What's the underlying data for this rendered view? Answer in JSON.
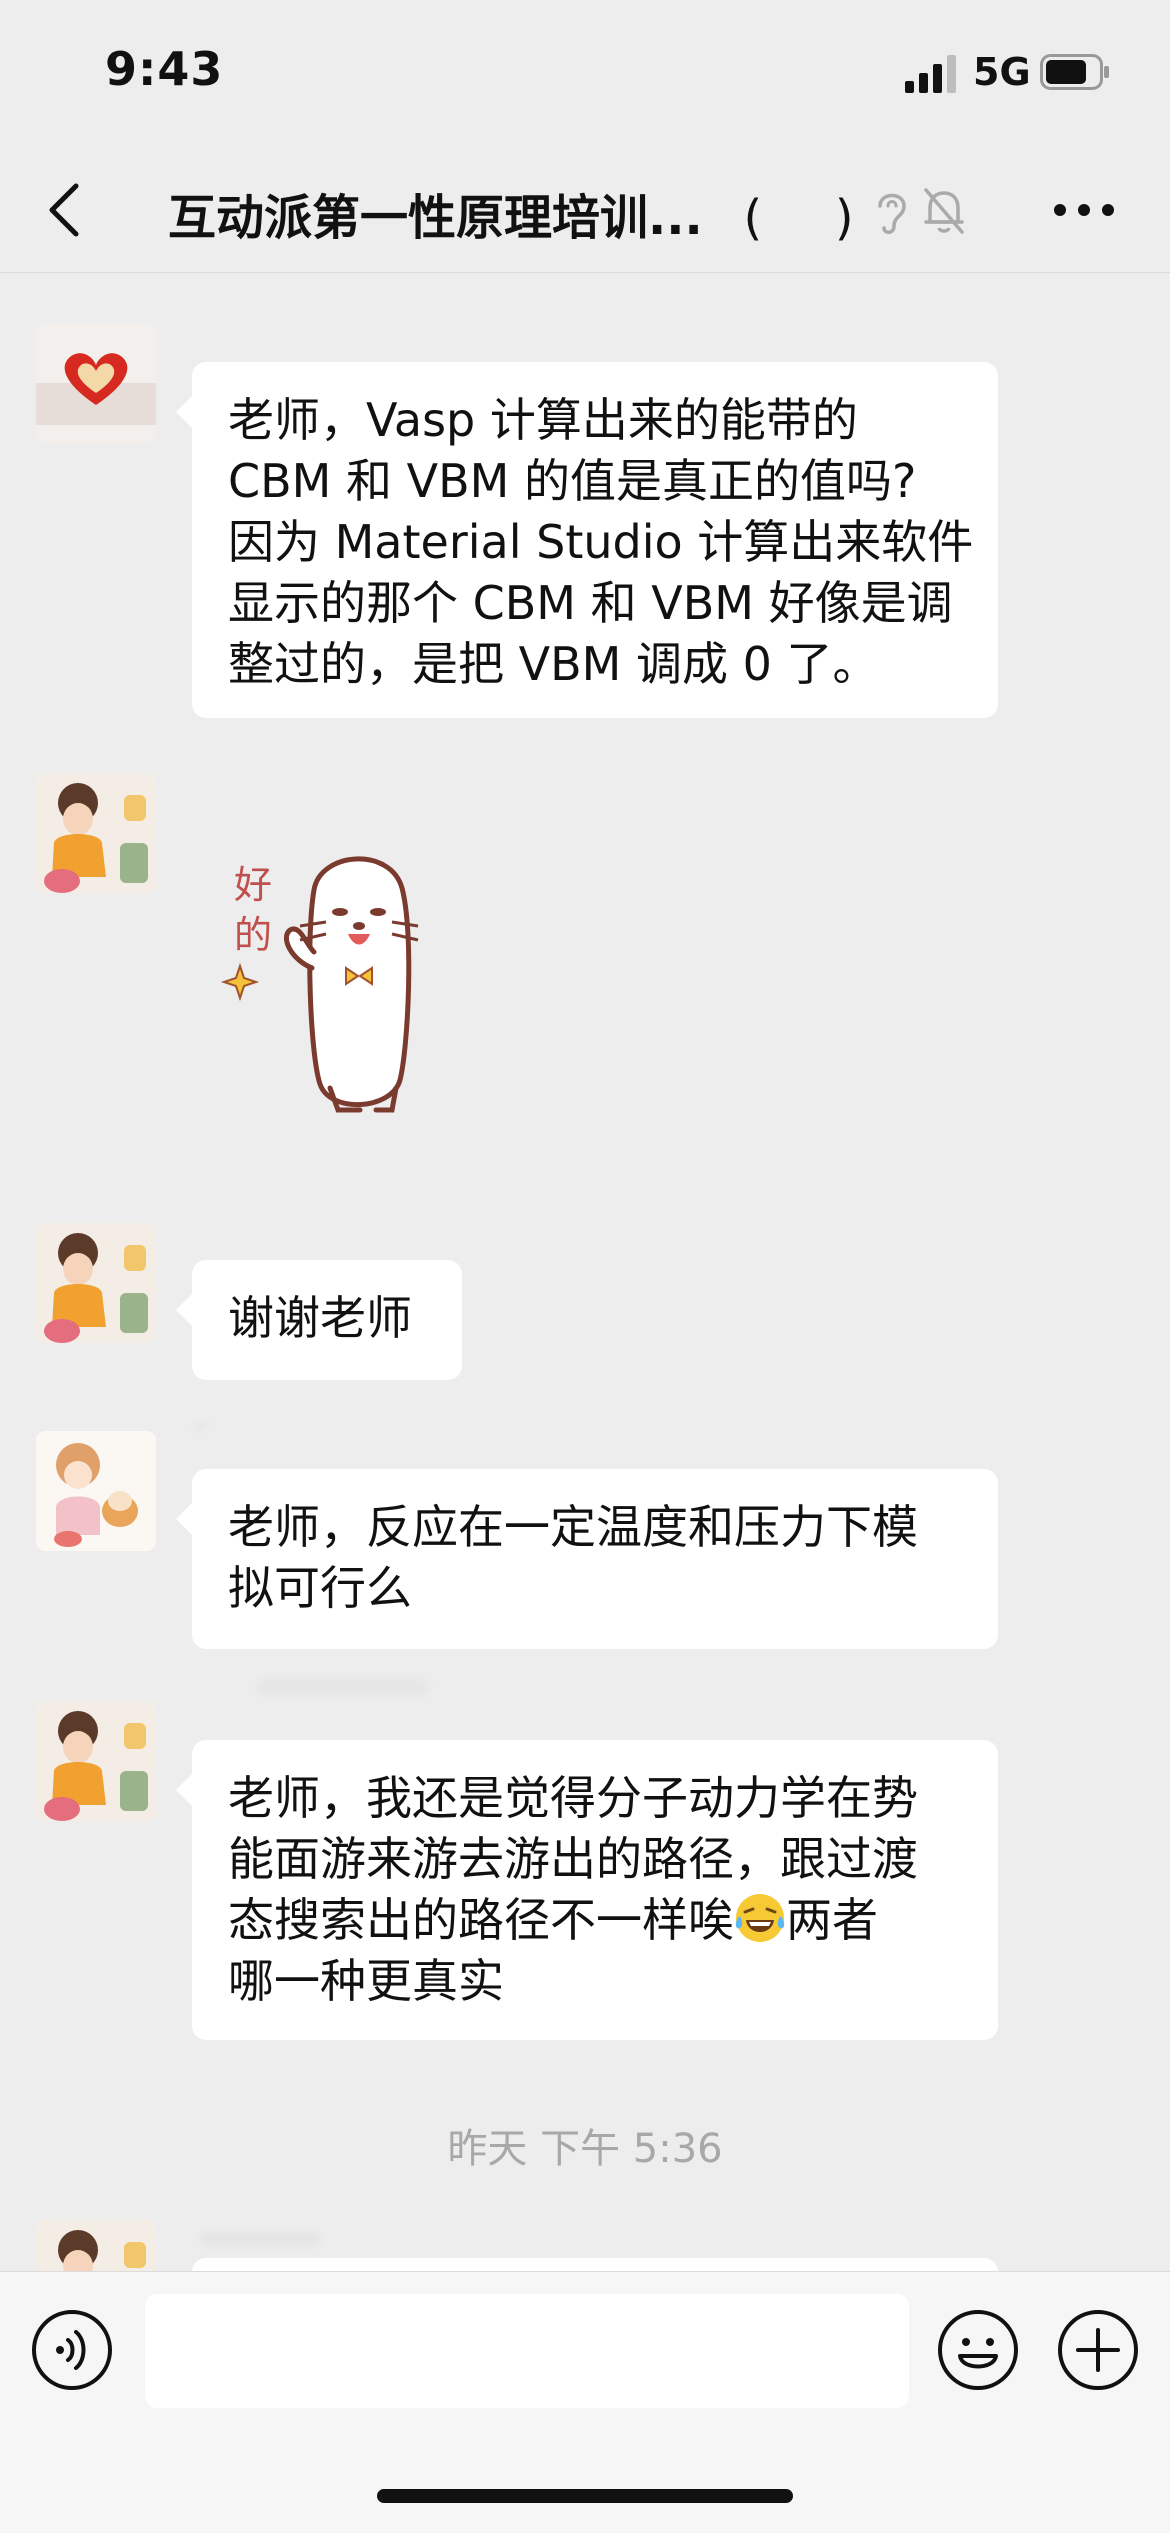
{
  "status": {
    "time": "9:43",
    "network": "5G"
  },
  "nav": {
    "title": "互动派第一性原理培训...",
    "paren_open": "(",
    "paren_close": ")"
  },
  "messages": [
    {
      "type": "text",
      "avatar": "heart-avatar",
      "lines": [
        "老师，Vasp 计算出来的能带的",
        "CBM 和 VBM 的值是真正的值吗?",
        "因为 Material Studio 计算出来软件",
        "显示的那个 CBM 和 VBM 好像是调",
        "整过的，是把 VBM 调成 0 了。"
      ]
    },
    {
      "type": "sticker",
      "avatar": "girl-avatar",
      "sticker_text": "好的"
    },
    {
      "type": "text",
      "avatar": "girl-avatar",
      "lines": [
        "谢谢老师"
      ]
    },
    {
      "type": "text",
      "avatar": "cartoon-avatar",
      "lines": [
        "老师，反应在一定温度和压力下模",
        "拟可行么"
      ]
    },
    {
      "type": "text",
      "avatar": "girl-avatar",
      "lines": [
        "老师，我还是觉得分子动力学在势",
        "能面游来游去游出的路径，跟过渡",
        "态搜索出的路径不一样唉",
        "两者",
        "哪一种更真实"
      ],
      "emoji": "laughing-tears-emoji"
    }
  ],
  "timestamp": "昨天 下午 5:36",
  "input": {
    "placeholder": ""
  },
  "colors": {
    "background": "#ededed",
    "bubble": "#ffffff",
    "timestamp": "#a8a8a8"
  }
}
